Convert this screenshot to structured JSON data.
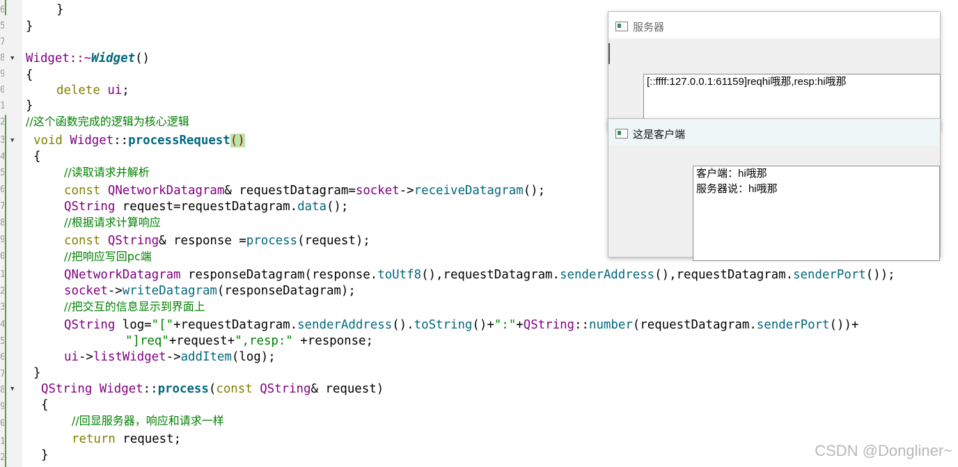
{
  "editor": {
    "lines": [
      "}",
      "}",
      "Widget::~Widget()",
      "{",
      "delete ui;",
      "}",
      "//这个函数完成的逻辑为核心逻辑",
      "void Widget::processRequest()",
      "{",
      "//读取请求并解析",
      "const QNetworkDatagram& requestDatagram=socket->receiveDatagram();",
      "QString request=requestDatagram.data();",
      "//根据请求计算响应",
      "const QString& response =process(request);",
      "//把响应写回pc端",
      "QNetworkDatagram responseDatagram(response.toUtf8(),requestDatagram.senderAddress(),requestDatagram.senderPort());",
      "socket->writeDatagram(responseDatagram);",
      "//把交互的信息显示到界面上",
      "QString log=\"[\"+requestDatagram.senderAddress().toString()+\":\"+QString::number(requestDatagram.senderPort())+",
      "\"]req\"+request+\",resp:\" +response;",
      "ui->listWidget->addItem(log);",
      "}",
      "QString Widget::process(const QString& request)",
      "{",
      "//回显服务器，响应和请求一样",
      "return request;",
      "}"
    ]
  },
  "server_window": {
    "title": "服务器",
    "list_items": [
      "[::ffff:127.0.0.1:61159]reqhi哦那,resp:hi哦那"
    ]
  },
  "client_window": {
    "title": "这是客户端",
    "list_items": [
      "客户端：hi哦那",
      "服务器说：hi哦那"
    ]
  },
  "watermark": "CSDN @Dongliner~"
}
